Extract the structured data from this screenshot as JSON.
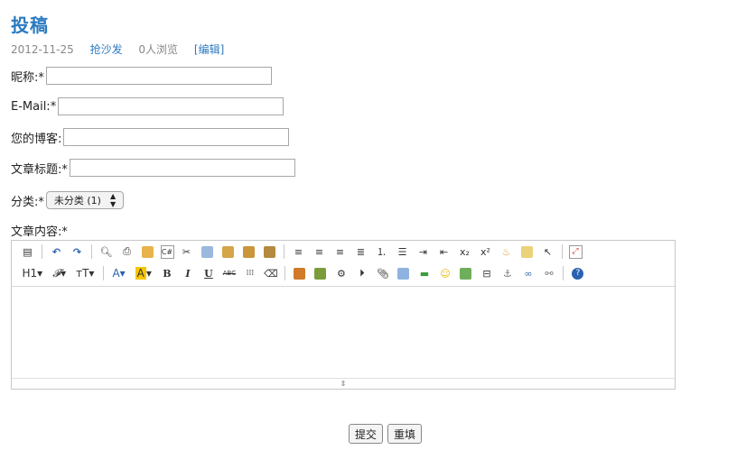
{
  "post": {
    "title": "投稿",
    "date": "2012-11-25",
    "sofa_link": "抢沙发",
    "views": "0人浏览",
    "edit_link": "[编辑]"
  },
  "form": {
    "nickname_label": "昵称:*",
    "email_label": "E-Mail:*",
    "blog_label": "您的博客:",
    "article_title_label": "文章标题:*",
    "category_label": "分类:*",
    "category_selected": "未分类 (1)",
    "content_label": "文章内容:*"
  },
  "editor": {
    "toolbar_row1": [
      "source-icon",
      "undo-icon",
      "redo-icon",
      "preview-icon",
      "print-icon",
      "template-icon",
      "code-icon",
      "cut-icon",
      "copy-icon",
      "paste-icon",
      "paste-text-icon",
      "paste-word-icon",
      "align-left-icon",
      "align-center-icon",
      "align-right-icon",
      "justify-icon",
      "ordered-list-icon",
      "unordered-list-icon",
      "indent-icon",
      "outdent-icon",
      "subscript-icon",
      "superscript-icon",
      "clear-format-icon",
      "select-all-icon",
      "cursor-icon",
      "fullscreen-icon"
    ],
    "toolbar_row2": [
      "heading-icon",
      "font-family-icon",
      "font-size-icon",
      "text-color-icon",
      "highlight-icon",
      "bold-icon",
      "italic-icon",
      "underline-icon",
      "strikethrough-icon",
      "line-height-icon",
      "eraser-icon",
      "image-icon",
      "multi-image-icon",
      "flash-icon",
      "media-icon",
      "attachment-icon",
      "table-icon",
      "horizontal-rule-icon",
      "emoticon-icon",
      "map-icon",
      "page-break-icon",
      "anchor-icon",
      "link-icon",
      "unlink-icon",
      "help-icon"
    ],
    "h1_label": "H1",
    "sub_label": "x₂",
    "sup_label": "x²",
    "bold_label": "B",
    "italic_label": "I",
    "underline_label": "U",
    "strike_label": "ABC",
    "accent_color": "#2b7ac1"
  },
  "buttons": {
    "submit": "提交",
    "reset": "重填"
  }
}
